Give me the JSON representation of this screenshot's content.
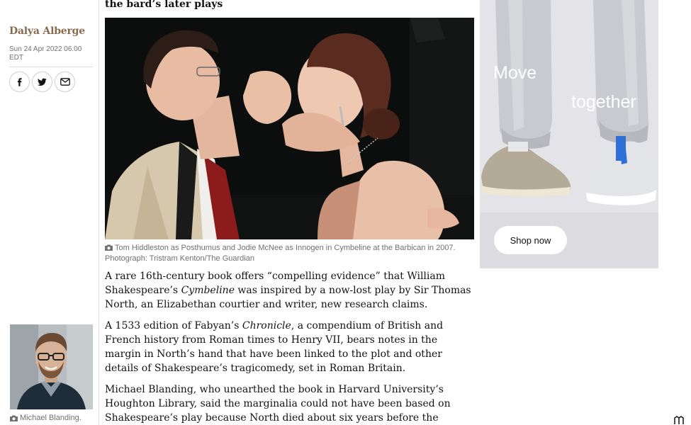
{
  "article": {
    "headline_tail": "the bard’s later plays",
    "byline": "Dalya Alberge",
    "dateline": "Sun 24 Apr 2022 06.00 EDT",
    "main_image": {
      "caption": "Tom Hiddleston as Posthumus and Jodie McNee as Innogen in Cymbeline at the Barbican in 2007. Photograph: Tristram Kenton/The Guardian"
    },
    "paragraphs": [
      {
        "p1_a": "A rare 16th-century book offers “compelling evidence” that William Shakespeare’s ",
        "p1_em": "Cymbeline",
        "p1_b": " was inspired by a now-lost play by Sir Thomas North, an Elizabethan courtier and writer, new research claims."
      },
      {
        "p2_a": "A 1533 edition of Fabyan’s ",
        "p2_em": "Chronicle",
        "p2_b": ", a compendium of British and French history from Roman times to Henry VII, bears notes in the margin in North’s hand that have been linked to the plot and other details of Shakespeare’s tragicomedy, set in Roman Britain."
      },
      {
        "p3": "Michael Blanding, who unearthed the book in Harvard University’s Houghton Library, said the marginalia could not have been based on Shakespeare’s play because North died about six years before the"
      }
    ],
    "side_image": {
      "caption": "Michael Blanding."
    }
  },
  "share": {
    "icons": [
      "facebook-icon",
      "twitter-icon",
      "email-icon"
    ]
  },
  "ad": {
    "text_move": "Move",
    "text_together": "together",
    "cta_label": "Shop now",
    "brand": "On"
  },
  "colors": {
    "byline": "#8a6a4e",
    "caption": "#707070",
    "divider": "#dcdcdc",
    "ad_background": "#e4e3e7"
  }
}
